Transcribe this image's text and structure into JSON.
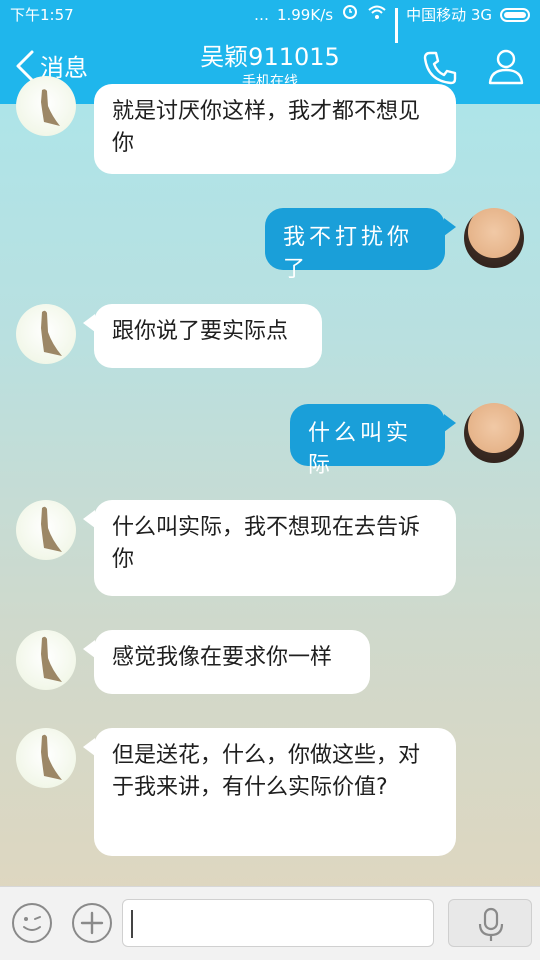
{
  "status": {
    "time": "下午1:57",
    "dots": "…",
    "speed": "1.99K/s",
    "carrier": "中国移动 3G"
  },
  "header": {
    "back_label": "消息",
    "contact_name": "吴颖911015",
    "contact_status": "手机在线"
  },
  "messages": [
    {
      "side": "left",
      "text": "就是讨厌你这样，我才都不想见你"
    },
    {
      "side": "right",
      "text": "我不打扰你了"
    },
    {
      "side": "left",
      "text": "跟你说了要实际点"
    },
    {
      "side": "right",
      "text": "什么叫实际"
    },
    {
      "side": "left",
      "text": "什么叫实际，我不想现在去告诉你"
    },
    {
      "side": "left",
      "text": "感觉我像在要求你一样"
    },
    {
      "side": "left",
      "text": "但是送花，什么，你做这些，对于我来讲，有什么实际价值?"
    }
  ],
  "input": {
    "value": ""
  },
  "colors": {
    "header": "#1fb6ec",
    "sent_bubble": "#1a9fd9",
    "received_bubble": "#ffffff"
  },
  "icons": {
    "back": "chevron-left-icon",
    "phone": "phone-icon",
    "contact": "contact-icon",
    "emoji": "emoji-icon",
    "plus": "plus-icon",
    "mic": "microphone-icon"
  }
}
